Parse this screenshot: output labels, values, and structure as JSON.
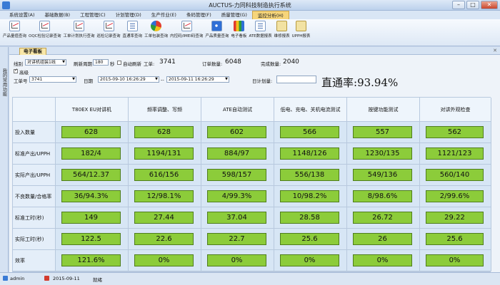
{
  "window": {
    "title": "AUCTUS-力同科技制造执行系统",
    "buttons": [
      "–",
      "□",
      "✕"
    ]
  },
  "menu": [
    {
      "label": "系统设置(A)",
      "active": false
    },
    {
      "label": "基础数据(B)",
      "active": false
    },
    {
      "label": "工程管理(C)",
      "active": false
    },
    {
      "label": "计划管理(D)",
      "active": false
    },
    {
      "label": "生产作业(E)",
      "active": false
    },
    {
      "label": "条码管理(F)",
      "active": false
    },
    {
      "label": "质量管理(G)",
      "active": false
    },
    {
      "label": "监控分析(H)",
      "active": true
    }
  ],
  "toolbar": [
    {
      "label": "产品量值查询",
      "icon": "chart-icon"
    },
    {
      "label": "OQC检验记录查询",
      "icon": "chart-icon"
    },
    {
      "label": "工单计划执行查询",
      "icon": "chart-icon"
    },
    {
      "label": "巡检记录查询",
      "icon": "chart-icon"
    },
    {
      "label": "直通率查询",
      "icon": "document-icon"
    },
    {
      "label": "工单包装查询",
      "icon": "pie-chart-icon"
    },
    {
      "label": "内控码/IMEI码查询",
      "icon": "chart-icon"
    },
    {
      "label": "产品质量查询",
      "icon": "grid-icon"
    },
    {
      "label": "电子看板",
      "icon": "color-bars-icon"
    },
    {
      "label": "ATE数据报表",
      "icon": "document-icon"
    },
    {
      "label": "维修报表",
      "icon": "book-icon"
    },
    {
      "label": "UPPH报表",
      "icon": "book-icon"
    }
  ],
  "left_tab": "我的常用功能",
  "panel": {
    "tab_label": "电子看板",
    "close": "✕"
  },
  "filters": {
    "line_label": "线别",
    "line_value": "对讲机组装1线",
    "refresh_label": "刷新周期",
    "refresh_value": "180",
    "refresh_unit": "秒",
    "auto_refresh_label": "自动刷新",
    "auto_refresh_checked": false,
    "workorder_label": "工单:",
    "workorder_value": "3741",
    "order_qty_label": "订单数量:",
    "order_qty_value": "6048",
    "done_qty_label": "完成数量:",
    "done_qty_value": "2040",
    "advanced_label": "高级",
    "advanced_checked": true,
    "wo_no_label": "工单号",
    "wo_no_value": "3741",
    "date_label": "日期",
    "date_from": "2015-09-10 16:26:29",
    "date_to": "2015-09-11 16:26:29",
    "date_sep": "--",
    "daily_plan_label": "日计划量:",
    "daily_plan_value": "",
    "yield_label": "直通率:",
    "yield_value": "93.94%"
  },
  "table": {
    "columns": [
      "T80EX EU对讲机",
      "频率调整、写频",
      "ATE自动测试",
      "低电、充电、关机电流测试",
      "按键功能测试",
      "对讲外观检查"
    ],
    "rows": [
      {
        "label": "投入数量",
        "values": [
          "628",
          "628",
          "602",
          "566",
          "557",
          "562"
        ]
      },
      {
        "label": "标准产出/UPPH",
        "values": [
          "182/4",
          "1194/131",
          "884/97",
          "1148/126",
          "1230/135",
          "1121/123"
        ]
      },
      {
        "label": "实际产出/UPPH",
        "values": [
          "564/12.37",
          "616/156",
          "598/157",
          "556/138",
          "549/136",
          "560/140"
        ]
      },
      {
        "label": "不良数量/合格率",
        "values": [
          "36/94.3%",
          "12/98.1%",
          "4/99.3%",
          "10/98.2%",
          "8/98.6%",
          "2/99.6%"
        ]
      },
      {
        "label": "标准工时(秒)",
        "values": [
          "149",
          "27.44",
          "37.04",
          "28.58",
          "26.72",
          "29.22"
        ]
      },
      {
        "label": "实际工时(秒)",
        "values": [
          "122.5",
          "22.6",
          "22.7",
          "25.6",
          "26",
          "25.6"
        ]
      },
      {
        "label": "效率",
        "values": [
          "121.6%",
          "0%",
          "0%",
          "0%",
          "0%",
          "0%"
        ]
      }
    ]
  },
  "status": {
    "user": "admin",
    "date": "2015-09-11",
    "state": "就绪"
  },
  "colors": {
    "cell_green": "#8ccc3a",
    "active_menu": "#f6d57a"
  }
}
